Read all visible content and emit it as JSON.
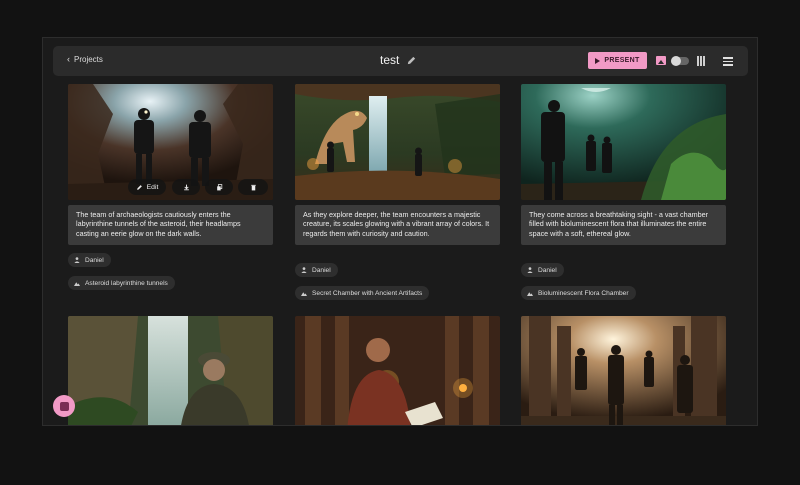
{
  "topbar": {
    "back_label": "Projects",
    "title": "test",
    "present_label": "PRESENT",
    "icons": [
      "chevron-left-icon",
      "pencil-icon",
      "play-icon",
      "image-icon",
      "toggle-switch",
      "film-strip-icon",
      "menu-icon"
    ]
  },
  "overlay_actions": {
    "edit_label": "Edit",
    "icons": [
      "pencil-icon",
      "download-icon",
      "copy-icon",
      "trash-icon"
    ]
  },
  "cards": [
    {
      "description": "The team of archaeologists cautiously enters the labyrinthine tunnels of the asteroid, their headlamps casting an eerie glow on the dark walls.",
      "character": "Daniel",
      "location": "Asteroid labyrinthine tunnels"
    },
    {
      "description": "As they explore deeper, the team encounters a majestic creature, its scales glowing with a vibrant array of colors. It regards them with curiosity and caution.",
      "character": "Daniel",
      "location": "Secret Chamber with Ancient Artifacts"
    },
    {
      "description": "They come across a breathtaking sight - a vast chamber filled with bioluminescent flora that illuminates the entire space with a soft, ethereal glow.",
      "character": "Daniel",
      "location": "Bioluminescent Flora Chamber"
    },
    {
      "description": "",
      "character": "",
      "location": ""
    },
    {
      "description": "",
      "character": "",
      "location": ""
    },
    {
      "description": "",
      "character": "",
      "location": ""
    }
  ],
  "colors": {
    "accent": "#f29ac6",
    "background": "#121212",
    "panel": "#1b1b1b",
    "topbar": "#2b2b2b",
    "description_box": "#3b3b3b",
    "chip": "#2e2e2e"
  }
}
